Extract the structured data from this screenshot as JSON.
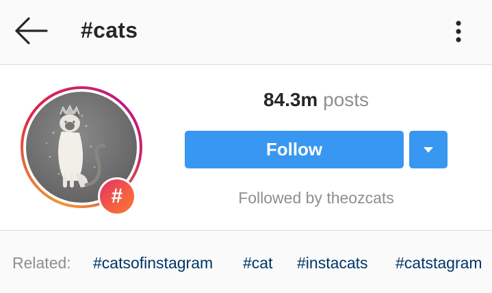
{
  "header": {
    "title": "#cats",
    "back_icon": "arrow-left-icon",
    "menu_icon": "more-vertical-icon"
  },
  "profile": {
    "avatar_icon": "cat-photo",
    "badge_icon": "hashtag-icon",
    "badge_text": "#",
    "posts_count": "84.3m",
    "posts_label": "posts",
    "follow_label": "Follow",
    "dropdown_icon": "caret-down-icon",
    "followed_by": "Followed by theozcats"
  },
  "related": {
    "label": "Related:",
    "tags": [
      "#catsofinstagram",
      "#cat",
      "#instacats",
      "#catstagram"
    ]
  },
  "colors": {
    "follow_blue": "#3897f0",
    "tag_link": "#003569",
    "muted_text": "#8e8e8e",
    "dark_text": "#262626"
  }
}
